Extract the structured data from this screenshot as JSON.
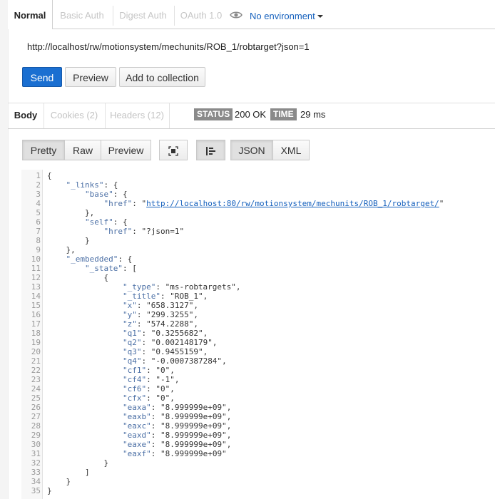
{
  "auth_tabs": [
    {
      "label": "Normal",
      "active": true
    },
    {
      "label": "Basic Auth",
      "active": false
    },
    {
      "label": "Digest Auth",
      "active": false
    },
    {
      "label": "OAuth 1.0",
      "active": false
    }
  ],
  "environment": {
    "label": "No environment",
    "icon": "eye-icon"
  },
  "request": {
    "url": "http://localhost/rw/motionsystem/mechunits/ROB_1/robtarget?json=1"
  },
  "actions": {
    "send": "Send",
    "preview": "Preview",
    "add": "Add to collection"
  },
  "response_tabs": [
    {
      "label": "Body",
      "active": true
    },
    {
      "label": "Cookies (2)",
      "active": false
    },
    {
      "label": "Headers (12)",
      "active": false
    }
  ],
  "status": {
    "label": "STATUS",
    "value": "200 OK"
  },
  "time": {
    "label": "TIME",
    "value": "29 ms"
  },
  "view": {
    "pretty": "Pretty",
    "raw": "Raw",
    "preview": "Preview",
    "json": "JSON",
    "xml": "XML",
    "expand_icon": "fullscreen-icon",
    "format_icon": "align-icon"
  },
  "code_lines": [
    [
      [
        "p",
        "{"
      ]
    ],
    [
      [
        "p",
        "    "
      ],
      [
        "k",
        "\"_links\""
      ],
      [
        "p",
        ": {"
      ]
    ],
    [
      [
        "p",
        "        "
      ],
      [
        "k",
        "\"base\""
      ],
      [
        "p",
        ": {"
      ]
    ],
    [
      [
        "p",
        "            "
      ],
      [
        "k",
        "\"href\""
      ],
      [
        "p",
        ": \""
      ],
      [
        "lnk",
        "http://localhost:80/rw/motionsystem/mechunits/ROB_1/robtarget/"
      ],
      [
        "p",
        "\""
      ]
    ],
    [
      [
        "p",
        "        },"
      ]
    ],
    [
      [
        "p",
        "        "
      ],
      [
        "k",
        "\"self\""
      ],
      [
        "p",
        ": {"
      ]
    ],
    [
      [
        "p",
        "            "
      ],
      [
        "k",
        "\"href\""
      ],
      [
        "p",
        ": "
      ],
      [
        "s",
        "\"?json=1\""
      ]
    ],
    [
      [
        "p",
        "        }"
      ]
    ],
    [
      [
        "p",
        "    },"
      ]
    ],
    [
      [
        "p",
        "    "
      ],
      [
        "k",
        "\"_embedded\""
      ],
      [
        "p",
        ": {"
      ]
    ],
    [
      [
        "p",
        "        "
      ],
      [
        "k",
        "\"_state\""
      ],
      [
        "p",
        ": ["
      ]
    ],
    [
      [
        "p",
        "            {"
      ]
    ],
    [
      [
        "p",
        "                "
      ],
      [
        "k",
        "\"_type\""
      ],
      [
        "p",
        ": "
      ],
      [
        "s",
        "\"ms-robtargets\""
      ],
      [
        "p",
        ","
      ]
    ],
    [
      [
        "p",
        "                "
      ],
      [
        "k",
        "\"_title\""
      ],
      [
        "p",
        ": "
      ],
      [
        "s",
        "\"ROB_1\""
      ],
      [
        "p",
        ","
      ]
    ],
    [
      [
        "p",
        "                "
      ],
      [
        "k",
        "\"x\""
      ],
      [
        "p",
        ": "
      ],
      [
        "s",
        "\"658.3127\""
      ],
      [
        "p",
        ","
      ]
    ],
    [
      [
        "p",
        "                "
      ],
      [
        "k",
        "\"y\""
      ],
      [
        "p",
        ": "
      ],
      [
        "s",
        "\"299.3255\""
      ],
      [
        "p",
        ","
      ]
    ],
    [
      [
        "p",
        "                "
      ],
      [
        "k",
        "\"z\""
      ],
      [
        "p",
        ": "
      ],
      [
        "s",
        "\"574.2288\""
      ],
      [
        "p",
        ","
      ]
    ],
    [
      [
        "p",
        "                "
      ],
      [
        "k",
        "\"q1\""
      ],
      [
        "p",
        ": "
      ],
      [
        "s",
        "\"0.3255682\""
      ],
      [
        "p",
        ","
      ]
    ],
    [
      [
        "p",
        "                "
      ],
      [
        "k",
        "\"q2\""
      ],
      [
        "p",
        ": "
      ],
      [
        "s",
        "\"0.002148179\""
      ],
      [
        "p",
        ","
      ]
    ],
    [
      [
        "p",
        "                "
      ],
      [
        "k",
        "\"q3\""
      ],
      [
        "p",
        ": "
      ],
      [
        "s",
        "\"0.9455159\""
      ],
      [
        "p",
        ","
      ]
    ],
    [
      [
        "p",
        "                "
      ],
      [
        "k",
        "\"q4\""
      ],
      [
        "p",
        ": "
      ],
      [
        "s",
        "\"-0.0007387284\""
      ],
      [
        "p",
        ","
      ]
    ],
    [
      [
        "p",
        "                "
      ],
      [
        "k",
        "\"cf1\""
      ],
      [
        "p",
        ": "
      ],
      [
        "s",
        "\"0\""
      ],
      [
        "p",
        ","
      ]
    ],
    [
      [
        "p",
        "                "
      ],
      [
        "k",
        "\"cf4\""
      ],
      [
        "p",
        ": "
      ],
      [
        "s",
        "\"-1\""
      ],
      [
        "p",
        ","
      ]
    ],
    [
      [
        "p",
        "                "
      ],
      [
        "k",
        "\"cf6\""
      ],
      [
        "p",
        ": "
      ],
      [
        "s",
        "\"0\""
      ],
      [
        "p",
        ","
      ]
    ],
    [
      [
        "p",
        "                "
      ],
      [
        "k",
        "\"cfx\""
      ],
      [
        "p",
        ": "
      ],
      [
        "s",
        "\"0\""
      ],
      [
        "p",
        ","
      ]
    ],
    [
      [
        "p",
        "                "
      ],
      [
        "k",
        "\"eaxa\""
      ],
      [
        "p",
        ": "
      ],
      [
        "s",
        "\"8.999999e+09\""
      ],
      [
        "p",
        ","
      ]
    ],
    [
      [
        "p",
        "                "
      ],
      [
        "k",
        "\"eaxb\""
      ],
      [
        "p",
        ": "
      ],
      [
        "s",
        "\"8.999999e+09\""
      ],
      [
        "p",
        ","
      ]
    ],
    [
      [
        "p",
        "                "
      ],
      [
        "k",
        "\"eaxc\""
      ],
      [
        "p",
        ": "
      ],
      [
        "s",
        "\"8.999999e+09\""
      ],
      [
        "p",
        ","
      ]
    ],
    [
      [
        "p",
        "                "
      ],
      [
        "k",
        "\"eaxd\""
      ],
      [
        "p",
        ": "
      ],
      [
        "s",
        "\"8.999999e+09\""
      ],
      [
        "p",
        ","
      ]
    ],
    [
      [
        "p",
        "                "
      ],
      [
        "k",
        "\"eaxe\""
      ],
      [
        "p",
        ": "
      ],
      [
        "s",
        "\"8.999999e+09\""
      ],
      [
        "p",
        ","
      ]
    ],
    [
      [
        "p",
        "                "
      ],
      [
        "k",
        "\"eaxf\""
      ],
      [
        "p",
        ": "
      ],
      [
        "s",
        "\"8.999999e+09\""
      ]
    ],
    [
      [
        "p",
        "            }"
      ]
    ],
    [
      [
        "p",
        "        ]"
      ]
    ],
    [
      [
        "p",
        "    }"
      ]
    ],
    [
      [
        "p",
        "}"
      ]
    ]
  ]
}
